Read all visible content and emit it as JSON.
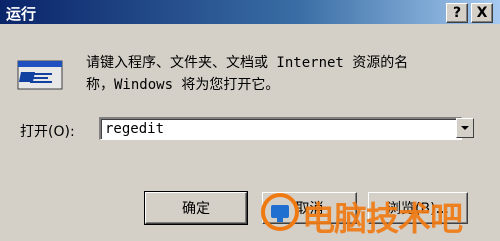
{
  "window": {
    "title": "运行",
    "help_label": "?",
    "close_label": "X"
  },
  "description": {
    "line1": "请键入程序、文件夹、文档或 Internet 资源的名",
    "line2": "称，Windows 将为您打开它。"
  },
  "open_field": {
    "label": "打开(O):",
    "value": "regedit"
  },
  "buttons": {
    "ok_label": "确定",
    "cancel_label": "取消",
    "browse_label": "浏览(B)..."
  },
  "watermark": {
    "text": "电脑技术吧",
    "color": "#f07a12"
  },
  "icons": {
    "run": "run-program-icon",
    "dropdown": "chevron-down-icon",
    "watermark_logo": "watermark-logo-icon"
  },
  "colors": {
    "dialog_bg": "#d4d0c8",
    "titlebar_start": "#0a246a",
    "titlebar_end": "#a6caf0"
  }
}
